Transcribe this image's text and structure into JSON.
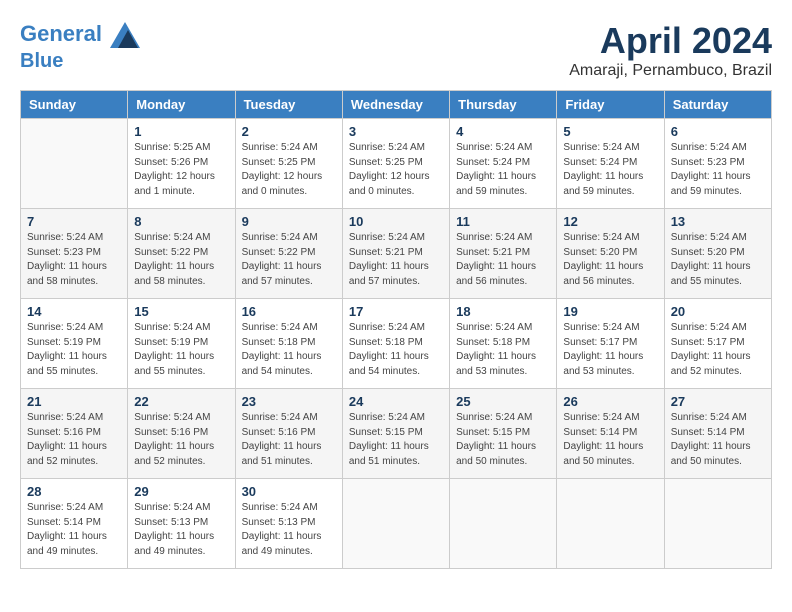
{
  "header": {
    "logo_line1": "General",
    "logo_line2": "Blue",
    "month_title": "April 2024",
    "location": "Amaraji, Pernambuco, Brazil"
  },
  "days_of_week": [
    "Sunday",
    "Monday",
    "Tuesday",
    "Wednesday",
    "Thursday",
    "Friday",
    "Saturday"
  ],
  "weeks": [
    [
      {
        "day": "",
        "info": ""
      },
      {
        "day": "1",
        "info": "Sunrise: 5:25 AM\nSunset: 5:26 PM\nDaylight: 12 hours\nand 1 minute."
      },
      {
        "day": "2",
        "info": "Sunrise: 5:24 AM\nSunset: 5:25 PM\nDaylight: 12 hours\nand 0 minutes."
      },
      {
        "day": "3",
        "info": "Sunrise: 5:24 AM\nSunset: 5:25 PM\nDaylight: 12 hours\nand 0 minutes."
      },
      {
        "day": "4",
        "info": "Sunrise: 5:24 AM\nSunset: 5:24 PM\nDaylight: 11 hours\nand 59 minutes."
      },
      {
        "day": "5",
        "info": "Sunrise: 5:24 AM\nSunset: 5:24 PM\nDaylight: 11 hours\nand 59 minutes."
      },
      {
        "day": "6",
        "info": "Sunrise: 5:24 AM\nSunset: 5:23 PM\nDaylight: 11 hours\nand 59 minutes."
      }
    ],
    [
      {
        "day": "7",
        "info": "Sunrise: 5:24 AM\nSunset: 5:23 PM\nDaylight: 11 hours\nand 58 minutes."
      },
      {
        "day": "8",
        "info": "Sunrise: 5:24 AM\nSunset: 5:22 PM\nDaylight: 11 hours\nand 58 minutes."
      },
      {
        "day": "9",
        "info": "Sunrise: 5:24 AM\nSunset: 5:22 PM\nDaylight: 11 hours\nand 57 minutes."
      },
      {
        "day": "10",
        "info": "Sunrise: 5:24 AM\nSunset: 5:21 PM\nDaylight: 11 hours\nand 57 minutes."
      },
      {
        "day": "11",
        "info": "Sunrise: 5:24 AM\nSunset: 5:21 PM\nDaylight: 11 hours\nand 56 minutes."
      },
      {
        "day": "12",
        "info": "Sunrise: 5:24 AM\nSunset: 5:20 PM\nDaylight: 11 hours\nand 56 minutes."
      },
      {
        "day": "13",
        "info": "Sunrise: 5:24 AM\nSunset: 5:20 PM\nDaylight: 11 hours\nand 55 minutes."
      }
    ],
    [
      {
        "day": "14",
        "info": "Sunrise: 5:24 AM\nSunset: 5:19 PM\nDaylight: 11 hours\nand 55 minutes."
      },
      {
        "day": "15",
        "info": "Sunrise: 5:24 AM\nSunset: 5:19 PM\nDaylight: 11 hours\nand 55 minutes."
      },
      {
        "day": "16",
        "info": "Sunrise: 5:24 AM\nSunset: 5:18 PM\nDaylight: 11 hours\nand 54 minutes."
      },
      {
        "day": "17",
        "info": "Sunrise: 5:24 AM\nSunset: 5:18 PM\nDaylight: 11 hours\nand 54 minutes."
      },
      {
        "day": "18",
        "info": "Sunrise: 5:24 AM\nSunset: 5:18 PM\nDaylight: 11 hours\nand 53 minutes."
      },
      {
        "day": "19",
        "info": "Sunrise: 5:24 AM\nSunset: 5:17 PM\nDaylight: 11 hours\nand 53 minutes."
      },
      {
        "day": "20",
        "info": "Sunrise: 5:24 AM\nSunset: 5:17 PM\nDaylight: 11 hours\nand 52 minutes."
      }
    ],
    [
      {
        "day": "21",
        "info": "Sunrise: 5:24 AM\nSunset: 5:16 PM\nDaylight: 11 hours\nand 52 minutes."
      },
      {
        "day": "22",
        "info": "Sunrise: 5:24 AM\nSunset: 5:16 PM\nDaylight: 11 hours\nand 52 minutes."
      },
      {
        "day": "23",
        "info": "Sunrise: 5:24 AM\nSunset: 5:16 PM\nDaylight: 11 hours\nand 51 minutes."
      },
      {
        "day": "24",
        "info": "Sunrise: 5:24 AM\nSunset: 5:15 PM\nDaylight: 11 hours\nand 51 minutes."
      },
      {
        "day": "25",
        "info": "Sunrise: 5:24 AM\nSunset: 5:15 PM\nDaylight: 11 hours\nand 50 minutes."
      },
      {
        "day": "26",
        "info": "Sunrise: 5:24 AM\nSunset: 5:14 PM\nDaylight: 11 hours\nand 50 minutes."
      },
      {
        "day": "27",
        "info": "Sunrise: 5:24 AM\nSunset: 5:14 PM\nDaylight: 11 hours\nand 50 minutes."
      }
    ],
    [
      {
        "day": "28",
        "info": "Sunrise: 5:24 AM\nSunset: 5:14 PM\nDaylight: 11 hours\nand 49 minutes."
      },
      {
        "day": "29",
        "info": "Sunrise: 5:24 AM\nSunset: 5:13 PM\nDaylight: 11 hours\nand 49 minutes."
      },
      {
        "day": "30",
        "info": "Sunrise: 5:24 AM\nSunset: 5:13 PM\nDaylight: 11 hours\nand 49 minutes."
      },
      {
        "day": "",
        "info": ""
      },
      {
        "day": "",
        "info": ""
      },
      {
        "day": "",
        "info": ""
      },
      {
        "day": "",
        "info": ""
      }
    ]
  ]
}
